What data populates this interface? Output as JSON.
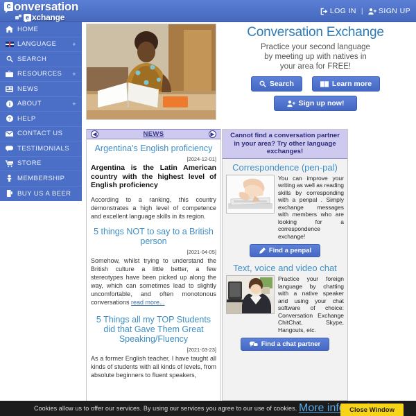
{
  "header": {
    "logo_line1": "onversation",
    "logo_c": "c",
    "logo_line2": "xchange",
    "logo_e": "e",
    "login_label": "LOG IN",
    "separator": "|",
    "signup_label": "SIGN UP",
    "login_icon": "sign-in-icon",
    "signup_icon": "user-plus-icon"
  },
  "sidebar": {
    "items": [
      {
        "label": "HOME",
        "icon": "home-icon",
        "expand": ""
      },
      {
        "label": "LANGUAGE",
        "icon": "uk-flag-icon",
        "expand": "+"
      },
      {
        "label": "SEARCH",
        "icon": "search-icon",
        "expand": ""
      },
      {
        "label": "RESOURCES",
        "icon": "briefcase-icon",
        "expand": "+"
      },
      {
        "label": "NEWS",
        "icon": "newspaper-icon",
        "expand": ""
      },
      {
        "label": "ABOUT",
        "icon": "info-icon",
        "expand": "+"
      },
      {
        "label": "HELP",
        "icon": "question-icon",
        "expand": ""
      },
      {
        "label": "CONTACT US",
        "icon": "envelope-icon",
        "expand": ""
      },
      {
        "label": "TESTIMONIALS",
        "icon": "comment-icon",
        "expand": ""
      },
      {
        "label": "STORE",
        "icon": "cart-icon",
        "expand": ""
      },
      {
        "label": "MEMBERSHIP",
        "icon": "person-icon",
        "expand": ""
      },
      {
        "label": "BUY US A BEER",
        "icon": "beer-icon",
        "expand": ""
      }
    ]
  },
  "hero": {
    "image_alt": "woman-reading-book-at-desk",
    "title": "Conversation Exchange",
    "subtitle_line1": "Practice your second language",
    "subtitle_line2": "by meeting up with natives in",
    "subtitle_line3": "your area for FREE!",
    "search_label": "Search",
    "search_icon": "search-icon",
    "learnmore_label": "Learn more",
    "learnmore_icon": "book-icon",
    "signup_label": "Sign up now!",
    "signup_icon": "user-plus-icon"
  },
  "news": {
    "panel_title": "NEWS",
    "prev_icon": "arrow-left-circle-icon",
    "next_icon": "arrow-right-circle-icon",
    "articles": [
      {
        "title": "Argentina's English proficiency",
        "date": "[2024-12-01]",
        "lead": "Argentina is the Latin American country with the highest level of English proficiency",
        "body": "According to a ranking, this country demonstrates a high level of competence and excellent language skills in its region.",
        "readmore": ""
      },
      {
        "title": "5 things NOT to say to a British person",
        "date": "[2021-04-05]",
        "lead": "",
        "body": "Somehow, whilst trying to understand the British culture a little better, a few stereotypes have been picked up along the way, which can sometimes lead to slightly uncomfortable, and often monotonous conversations ",
        "readmore": "read more..."
      },
      {
        "title": "5 Things all my TOP Students did that Gave Them Great Speaking/Fluency",
        "date": "[2021-03-23]",
        "lead": "",
        "body": "As a former English teacher, I have taught all kinds of students with all kinds of levels, from absolute beginners to fluent speakers,",
        "readmore": ""
      }
    ]
  },
  "promo": {
    "banner_line1": "Cannot find a conversation partner",
    "banner_line2": "in your area? Try other language",
    "banner_line3": "exchanges!",
    "sections": [
      {
        "title": "Correspondence (pen-pal)",
        "image_alt": "hand-typing-on-keyboard",
        "text": "You can improve your writing as well as reading skills by corresponding with a penpal . Simply exchange messages with members who are looking for a correspondence exchange!",
        "button_label": "Find a penpal",
        "button_icon": "pen-icon"
      },
      {
        "title": "Text, voice and video chat",
        "image_alt": "woman-with-headset-at-computer",
        "text": "Practice your foreign language by chatting with a native speaker and using your chat software of choice: Conversation Exchange ChitChat, Skype, Hangouts, etc.",
        "button_label": "Find a chat partner",
        "button_icon": "chat-bubbles-icon"
      }
    ]
  },
  "cookie": {
    "text": "Cookies allow us to offer our services. By using our services you agree to our use of cookies.",
    "link_label": "More information",
    "close_label": "Close Window"
  },
  "colors": {
    "brand_blue": "#4b6fc6",
    "accent_blue": "#3f8ec4",
    "panel_purple": "#cdc9ef",
    "cookie_yellow": "#f7d417",
    "panel_gray": "#f2f2f2"
  }
}
